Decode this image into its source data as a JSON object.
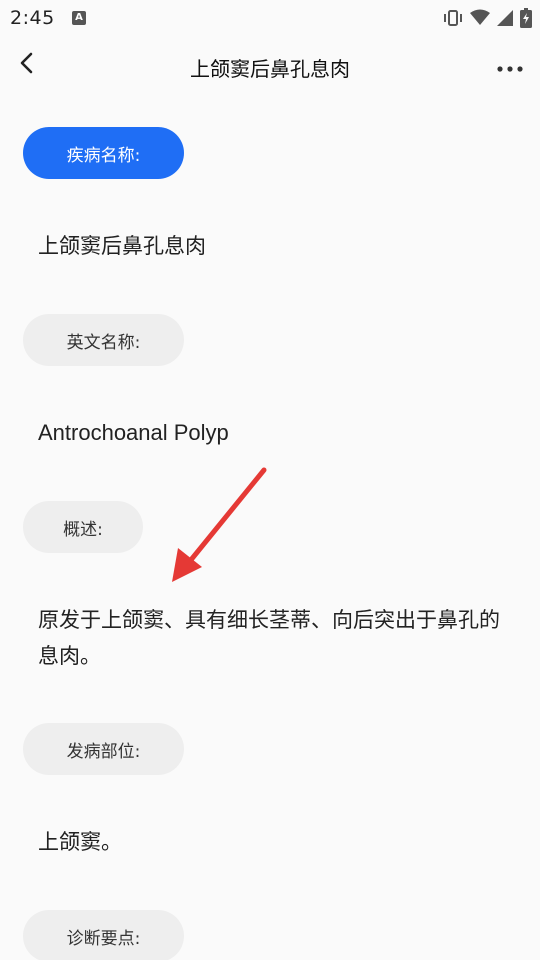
{
  "status_bar": {
    "time": "2:45",
    "notification_icon": "a-letter-icon",
    "icons": [
      "vibrate-icon",
      "wifi-icon",
      "signal-icon",
      "battery-charging-icon"
    ]
  },
  "header": {
    "back_icon": "chevron-left-icon",
    "title": "上颌窦后鼻孔息肉",
    "more_icon": "more-horizontal-icon"
  },
  "sections": [
    {
      "label": "疾病名称:",
      "value": "上颌窦后鼻孔息肉",
      "active": true
    },
    {
      "label": "英文名称:",
      "value": "Antrochoanal Polyp",
      "active": false
    },
    {
      "label": "概述:",
      "value": "原发于上颌窦、具有细长茎蒂、向后突出于鼻孔的息肉。",
      "active": false
    },
    {
      "label": "发病部位:",
      "value": "上颌窦。",
      "active": false
    },
    {
      "label": "诊断要点:",
      "value": "",
      "active": false
    }
  ],
  "colors": {
    "accent": "#1f6ef5",
    "chip_bg": "#eeeeee",
    "annotation_arrow": "#e53935"
  }
}
